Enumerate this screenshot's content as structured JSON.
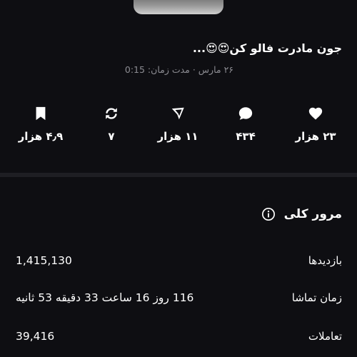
{
  "post": {
    "caption": "جون مادرت فالو کن😍😍...",
    "meta": "۲۶ مارس · مدت زمان: 0:15"
  },
  "stats": {
    "likes": {
      "icon": "heart-icon",
      "value": "۲۳ هزار"
    },
    "comments": {
      "icon": "comment-icon",
      "value": "۴۳۴"
    },
    "shares": {
      "icon": "send-icon",
      "value": "۱۱ هزار"
    },
    "reposts": {
      "icon": "repost-icon",
      "value": "۷"
    },
    "saves": {
      "icon": "bookmark-icon",
      "value": "۴٫۹ هزار"
    }
  },
  "overview": {
    "title": "مرور کلی",
    "icon": "info-icon",
    "rows": [
      {
        "label": "بازدیدها",
        "value": "1,415,130"
      },
      {
        "label": "زمان تماشا",
        "value": "116 روز 16 ساعت 33 دقیقه 53 ثانیه"
      },
      {
        "label": "تعاملات",
        "value": "39,416"
      }
    ]
  },
  "colors": {
    "background": "#0e0e12",
    "text": "#ffffff",
    "muted": "#8c8c92",
    "divider": "#1e1e23"
  }
}
